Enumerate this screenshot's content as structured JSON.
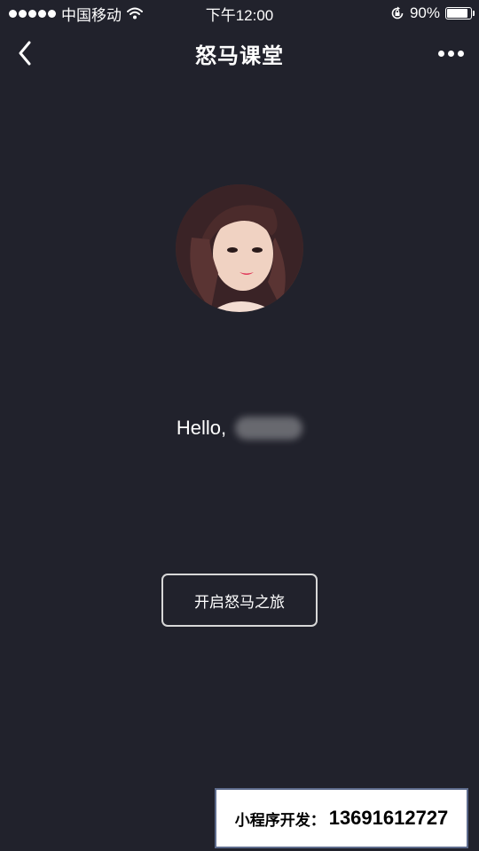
{
  "status_bar": {
    "carrier": "中国移动",
    "time": "下午12:00",
    "battery_percent": "90%",
    "battery_level": 0.9
  },
  "nav": {
    "title": "怒马课堂"
  },
  "greeting": {
    "hello": "Hello,"
  },
  "start_button": {
    "label": "开启怒马之旅"
  },
  "promo": {
    "label": "小程序开发：",
    "phone": "13691612727"
  },
  "colors": {
    "background": "#21222c",
    "text": "#ffffff",
    "button_border": "#d8d8d8"
  },
  "icons": [
    "wifi-icon",
    "orientation-lock-icon",
    "battery-icon",
    "back-chevron-icon",
    "more-dots-icon"
  ]
}
